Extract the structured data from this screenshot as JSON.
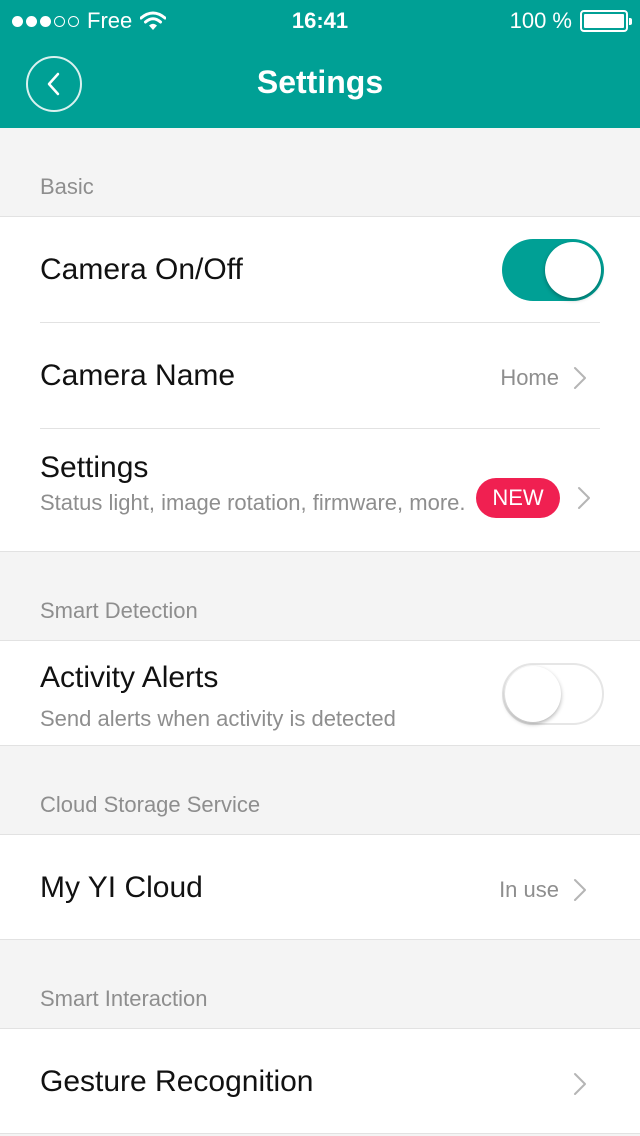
{
  "status_bar": {
    "carrier": "Free",
    "time": "16:41",
    "battery": "100 %"
  },
  "header": {
    "title": "Settings"
  },
  "sections": {
    "basic": {
      "label": "Basic",
      "camera_on_off": {
        "title": "Camera On/Off",
        "toggle_on": true
      },
      "camera_name": {
        "title": "Camera Name",
        "value": "Home"
      },
      "settings": {
        "title": "Settings",
        "subtitle": "Status light, image rotation, firmware, more.",
        "badge": "NEW"
      }
    },
    "smart_detection": {
      "label": "Smart Detection",
      "activity_alerts": {
        "title": "Activity Alerts",
        "subtitle": "Send alerts when activity is detected",
        "toggle_on": false
      }
    },
    "cloud": {
      "label": "Cloud Storage Service",
      "my_yi_cloud": {
        "title": "My YI Cloud",
        "value": "In use"
      }
    },
    "smart_interaction": {
      "label": "Smart Interaction",
      "gesture_recognition": {
        "title": "Gesture Recognition"
      }
    }
  },
  "colors": {
    "accent": "#00a095",
    "badge": "#f02051"
  }
}
